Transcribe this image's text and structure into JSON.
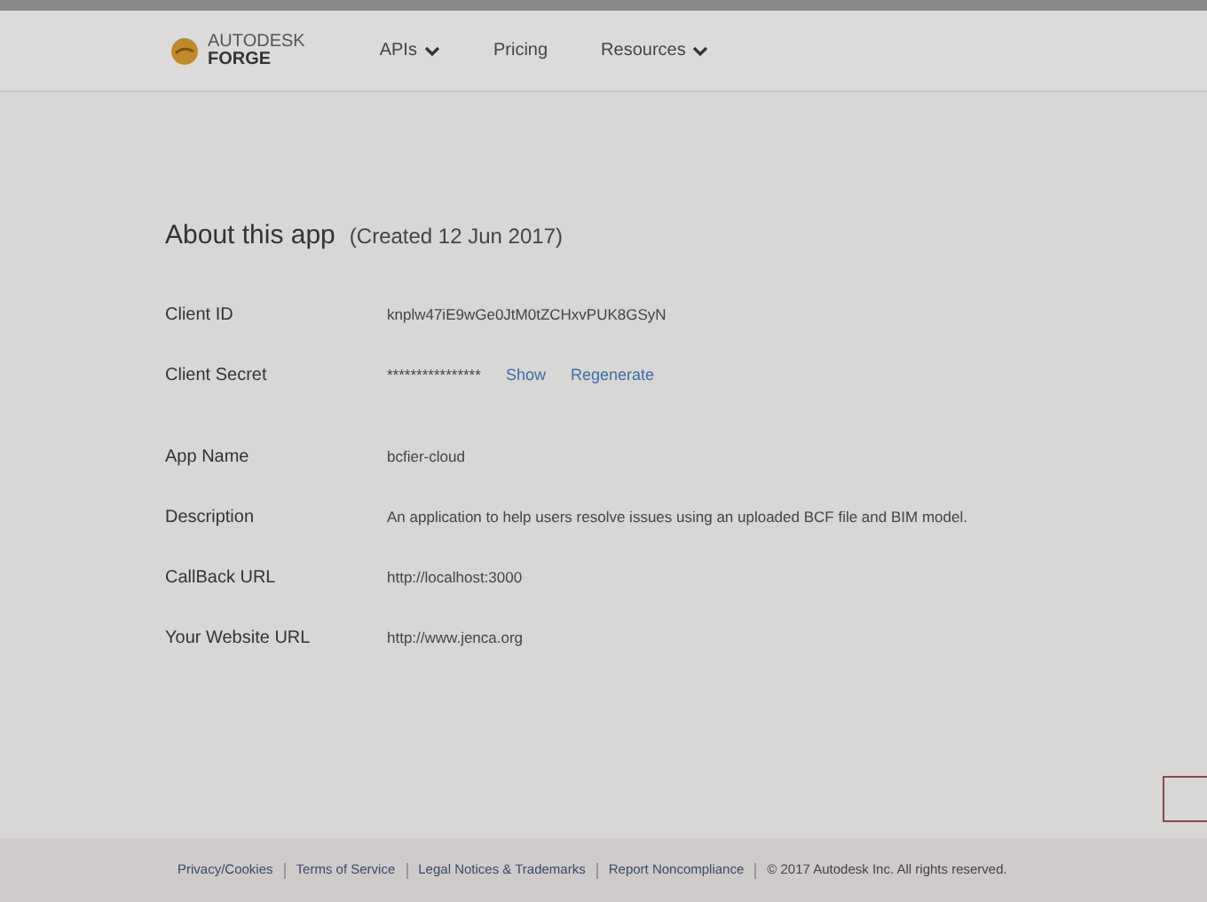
{
  "nav": {
    "logo": {
      "line1": "AUTODESK",
      "line2": "FORGE"
    },
    "items": [
      {
        "label": "APIs",
        "dropdown": true
      },
      {
        "label": "Pricing",
        "dropdown": false
      },
      {
        "label": "Resources",
        "dropdown": true
      }
    ]
  },
  "heading": {
    "title": "About this app",
    "created": "(Created 12 Jun 2017)"
  },
  "fields": [
    {
      "label": "Client ID",
      "value": "knplw47iE9wGe0JtM0tZCHxvPUK8GSyN"
    },
    {
      "label": "Client Secret",
      "value": "****************",
      "links": [
        "Show",
        "Regenerate"
      ]
    },
    {
      "label": "App Name",
      "value": "bcfier-cloud"
    },
    {
      "label": "Description",
      "value": "An application to help users resolve issues using an uploaded BCF file and BIM model."
    },
    {
      "label": "CallBack URL",
      "value": "http://localhost:3000"
    },
    {
      "label": "Your Website URL",
      "value": "http://www.jenca.org"
    }
  ],
  "footer": {
    "links": [
      "Privacy/Cookies",
      "Terms of Service",
      "Legal Notices & Trademarks",
      "Report Noncompliance"
    ],
    "copyright": "© 2017 Autodesk Inc. All rights reserved."
  }
}
